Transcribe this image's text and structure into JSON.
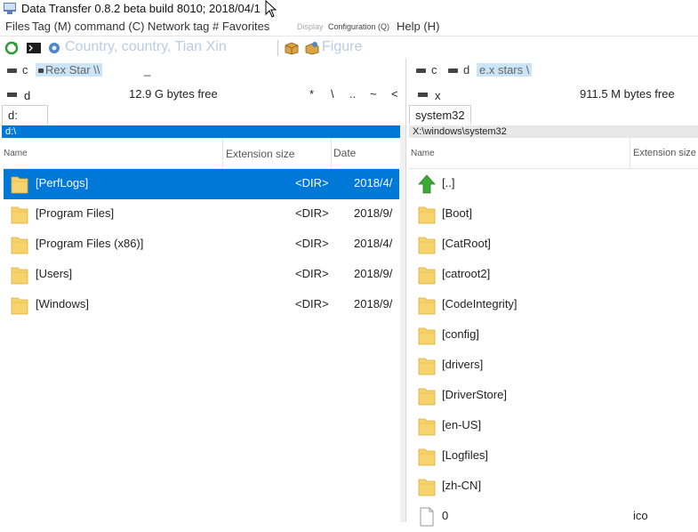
{
  "window": {
    "title": "Data Transfer 0.8.2 beta build 8010; 2018/04/1"
  },
  "menu": [
    {
      "label": "Files",
      "style": "normal"
    },
    {
      "label": "Tag (M) command (C) Network tag # Favorites",
      "style": "normal"
    },
    {
      "label": "Display",
      "style": "small-faded"
    },
    {
      "label": "Configuration (Q)",
      "style": "small"
    },
    {
      "label": "Help (H)",
      "style": "normal"
    }
  ],
  "toolbar": {
    "bookmarks": "Country, country, Tian Xin",
    "figure": "Figure"
  },
  "left_panel": {
    "drives": [
      {
        "label": "c",
        "selected": false
      },
      {
        "label": "Rex Star \\\\",
        "selected": true
      },
      {
        "label": "_",
        "selected": false
      }
    ],
    "drive": "d",
    "free": "12.9 G bytes free",
    "nav": [
      "*",
      "\\",
      "..",
      "~",
      "<"
    ],
    "tab": "d:",
    "path": "d:\\",
    "columns": {
      "name": "Name",
      "ext_size": "Extension size",
      "date": "Date"
    },
    "rows": [
      {
        "name": "[PerfLogs]",
        "type": "<DIR>",
        "date": "2018/4/",
        "selected": true
      },
      {
        "name": "[Program Files]",
        "type": "<DIR>",
        "date": "2018/9/",
        "selected": false
      },
      {
        "name": "[Program Files (x86)]",
        "type": "<DIR>",
        "date": "2018/4/",
        "selected": false
      },
      {
        "name": "[Users]",
        "type": "<DIR>",
        "date": "2018/9/",
        "selected": false
      },
      {
        "name": "[Windows]",
        "type": "<DIR>",
        "date": "2018/9/",
        "selected": false
      }
    ]
  },
  "right_panel": {
    "drives": [
      {
        "label": "c",
        "selected": false
      },
      {
        "label": "d",
        "selected": false
      },
      {
        "label": "e.x stars \\",
        "selected": true
      }
    ],
    "drive": "x",
    "free": "911.5 M bytes free",
    "tab": "system32",
    "path": "X:\\windows\\system32",
    "columns": {
      "name": "Name",
      "ext_size": "Extension size"
    },
    "rows": [
      {
        "name": "[..]",
        "kind": "up"
      },
      {
        "name": "[Boot]",
        "kind": "folder"
      },
      {
        "name": "[CatRoot]",
        "kind": "folder"
      },
      {
        "name": "[catroot2]",
        "kind": "folder"
      },
      {
        "name": "[CodeIntegrity]",
        "kind": "folder"
      },
      {
        "name": "[config]",
        "kind": "folder"
      },
      {
        "name": "[drivers]",
        "kind": "folder"
      },
      {
        "name": "[DriverStore]",
        "kind": "folder"
      },
      {
        "name": "[en-US]",
        "kind": "folder"
      },
      {
        "name": "[Logfiles]",
        "kind": "folder"
      },
      {
        "name": "[zh-CN]",
        "kind": "folder"
      },
      {
        "name": "0",
        "kind": "file",
        "ext": "ico"
      }
    ]
  },
  "colors": {
    "selection": "#0078d7",
    "path_bar_active": "#0078d7",
    "path_bar_inactive": "#e8e8e8",
    "folder": "#f7d36b",
    "up_arrow": "#3aa935",
    "drive_selected": "#cce4f7"
  }
}
